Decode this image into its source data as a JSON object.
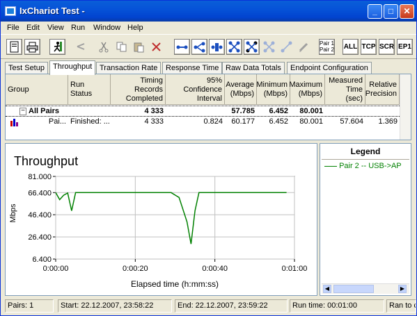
{
  "window": {
    "title": "IxChariot Test -"
  },
  "menu": [
    "File",
    "Edit",
    "View",
    "Run",
    "Window",
    "Help"
  ],
  "toolbar": {
    "pair_label_1": "Pair 1",
    "pair_label_2": "Pair 2",
    "all": "ALL",
    "tcp": "TCP",
    "scr": "SCR",
    "ep1": "EP1"
  },
  "tabs": [
    "Test Setup",
    "Throughput",
    "Transaction Rate",
    "Response Time",
    "Raw Data Totals",
    "Endpoint Configuration"
  ],
  "table": {
    "headers": [
      "Group",
      "Run Status",
      "Timing Records Completed",
      "95% Confidence Interval",
      "Average (Mbps)",
      "Minimum (Mbps)",
      "Maximum (Mbps)",
      "Measured Time (sec)",
      "Relative Precision"
    ],
    "group_row": {
      "expand": "−",
      "name": "All Pairs",
      "records": "4 333",
      "average": "57.785",
      "minimum": "6.452",
      "maximum": "80.001"
    },
    "pair_row": {
      "name": "Pai...",
      "status": "Finished: ...",
      "records": "4 333",
      "ci": "0.824",
      "average": "60.177",
      "minimum": "6.452",
      "maximum": "80.001",
      "time": "57.604",
      "precision": "1.369"
    }
  },
  "chart_data": {
    "type": "line",
    "title": "Throughput",
    "xlabel": "Elapsed time (h:mm:ss)",
    "ylabel": "Mbps",
    "ylim": [
      6.4,
      81.0
    ],
    "yticks": [
      "81.000",
      "66.400",
      "46.400",
      "26.400",
      "6.400"
    ],
    "xticks": [
      "0:00:00",
      "0:00:20",
      "0:00:40",
      "0:01:00"
    ],
    "grid": true,
    "series": [
      {
        "name": "Pair 2 -- USB->AP",
        "color": "#008000",
        "x": [
          "0:00:00",
          "0:00:01",
          "0:00:02",
          "0:00:03",
          "0:00:04",
          "0:00:05",
          "0:00:08",
          "0:00:11",
          "0:00:14",
          "0:00:17",
          "0:00:20",
          "0:00:23",
          "0:00:26",
          "0:00:29",
          "0:00:31",
          "0:00:33",
          "0:00:34",
          "0:00:35",
          "0:00:36",
          "0:00:38",
          "0:00:41",
          "0:00:44",
          "0:00:47",
          "0:00:50",
          "0:00:53",
          "0:00:56",
          "0:00:58"
        ],
        "values": [
          66.4,
          60.0,
          64.0,
          66.0,
          50.0,
          66.4,
          66.4,
          66.4,
          66.4,
          66.4,
          66.4,
          66.4,
          66.4,
          66.4,
          62.0,
          40.0,
          20.0,
          50.0,
          66.4,
          66.4,
          66.4,
          66.4,
          66.4,
          66.4,
          66.4,
          66.4,
          66.4
        ]
      }
    ]
  },
  "legend": {
    "title": "Legend",
    "item": "Pair 2 -- USB->AP"
  },
  "status": {
    "pairs": "Pairs: 1",
    "start": "Start: 22.12.2007, 23:58:22",
    "end": "End: 22.12.2007, 23:59:22",
    "runtime": "Run time: 00:01:00",
    "ran": "Ran to c"
  }
}
